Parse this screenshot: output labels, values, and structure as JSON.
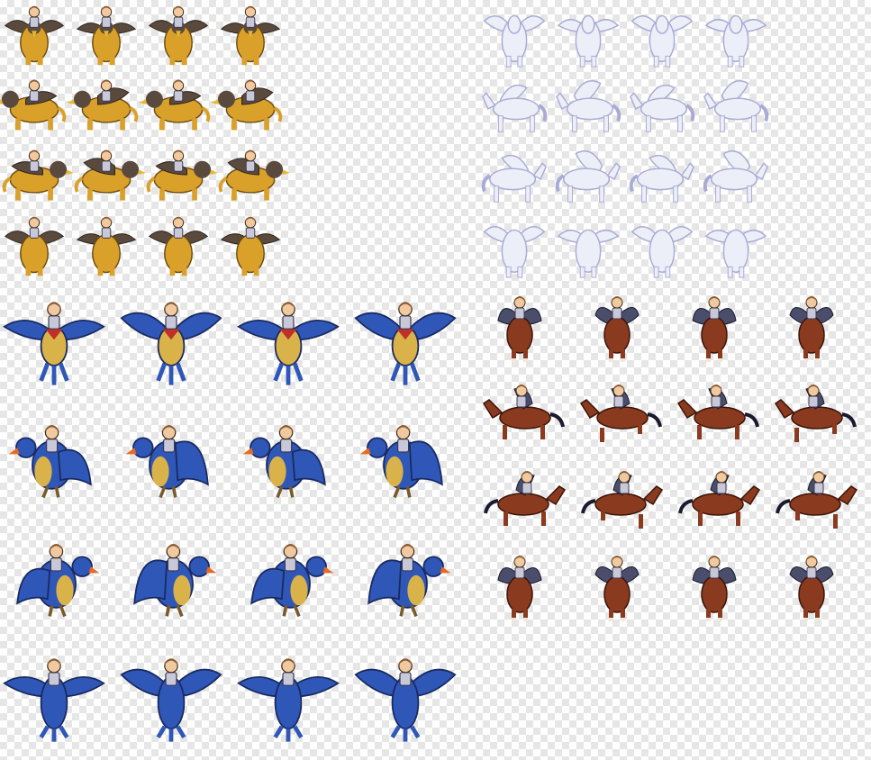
{
  "colors": {
    "griffin_body": "#d9a02a",
    "griffin_wing": "#5a4a3e",
    "pegasus_body": "#eceef8",
    "pegasus_outline": "#a9abd6",
    "bird_body": "#2f57b8",
    "bird_belly": "#d9b24a",
    "horse_body": "#8a3a1e",
    "horse_wing": "#4a4e6a",
    "rider_hair": "#8a5a30",
    "rider_armor": "#c8c8d8"
  },
  "sheets": [
    {
      "id": "griffin",
      "mount": "griffin",
      "columns": 4,
      "rows": 4,
      "directions": [
        "down",
        "left",
        "right",
        "up"
      ]
    },
    {
      "id": "pegasus",
      "mount": "pegasus",
      "columns": 4,
      "rows": 4,
      "directions": [
        "down",
        "left",
        "right",
        "up"
      ]
    },
    {
      "id": "bird",
      "mount": "bird",
      "columns": 4,
      "rows": 4,
      "directions": [
        "down",
        "left",
        "right",
        "up"
      ]
    },
    {
      "id": "horse",
      "mount": "winged-horse",
      "columns": 4,
      "rows": 4,
      "directions": [
        "down",
        "left",
        "right",
        "up"
      ]
    }
  ]
}
